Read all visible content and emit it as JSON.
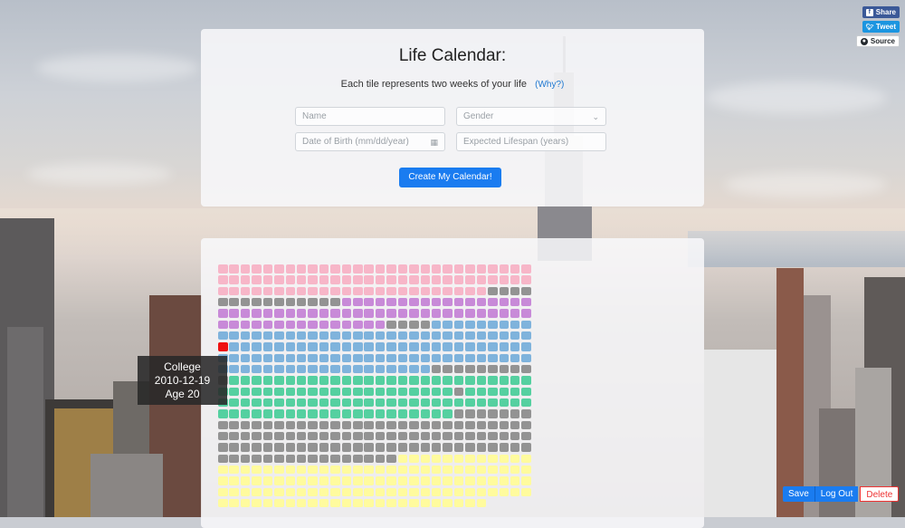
{
  "share": {
    "facebook_label": "Share",
    "twitter_label": "Tweet",
    "github_label": "Source"
  },
  "header": {
    "title": "Life Calendar:",
    "subtitle": "Each tile represents two weeks of your life",
    "why_link": "(Why?)"
  },
  "form": {
    "name_placeholder": "Name",
    "gender_placeholder": "Gender",
    "dob_placeholder": "Date of Birth (mm/dd/year)",
    "lifespan_placeholder": "Expected Lifespan (years)",
    "create_button": "Create My Calendar!"
  },
  "calendar": {
    "columns": 28,
    "segments": [
      {
        "color": "#f7b6c8",
        "count": 80
      },
      {
        "color": "#939393",
        "count": 15
      },
      {
        "color": "#c88ad8",
        "count": 60
      },
      {
        "color": "#939393",
        "count": 4
      },
      {
        "color": "#7fb3dc",
        "count": 112
      },
      {
        "color": "#939393",
        "count": 10
      },
      {
        "color": "#55d0a0",
        "count": 48
      },
      {
        "color": "#939393",
        "count": 1
      },
      {
        "color": "#55d0a0",
        "count": 55
      },
      {
        "color": "#939393",
        "count": 107
      },
      {
        "color": "#fffb9e",
        "count": 120
      }
    ],
    "highlight_index": 196,
    "highlight_color": "#ee1111"
  },
  "tooltip": {
    "line1": "College",
    "line2": "2010-12-19",
    "line3": "Age 20"
  },
  "actions": {
    "save": "Save",
    "logout": "Log Out",
    "delete": "Delete"
  }
}
